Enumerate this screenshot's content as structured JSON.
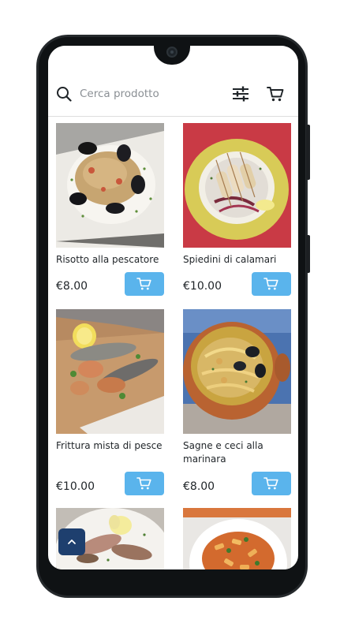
{
  "search": {
    "placeholder": "Cerca prodotto"
  },
  "icons": {
    "search": "search-icon",
    "filter": "sliders-icon",
    "cart": "shopping-cart-icon",
    "add_to_cart": "cart-add-icon",
    "scroll_top": "chevron-up-icon"
  },
  "colors": {
    "add_button": "#5ab4ec",
    "scroll_top_button": "#1e3f6e",
    "text": "#1f2428",
    "phone_frame": "#25292c"
  },
  "products": [
    {
      "name": "Risotto alla pescatore",
      "price": "€8.00",
      "image": "seafood risotto with mussels"
    },
    {
      "name": "Spiedini di calamari",
      "price": "€10.00",
      "image": "grilled squid skewers on yellow plate"
    },
    {
      "name": "Frittura mista di pesce",
      "price": "€10.00",
      "image": "mixed fried fish with lemon"
    },
    {
      "name": "Sagne e ceci alla marinara",
      "price": "€8.00",
      "image": "pasta with chickpeas and mussels in clay bowl"
    },
    {
      "name": "",
      "price": "",
      "image": "grilled prawns with lemon"
    },
    {
      "name": "",
      "price": "",
      "image": "pasta with tomato sauce"
    }
  ]
}
